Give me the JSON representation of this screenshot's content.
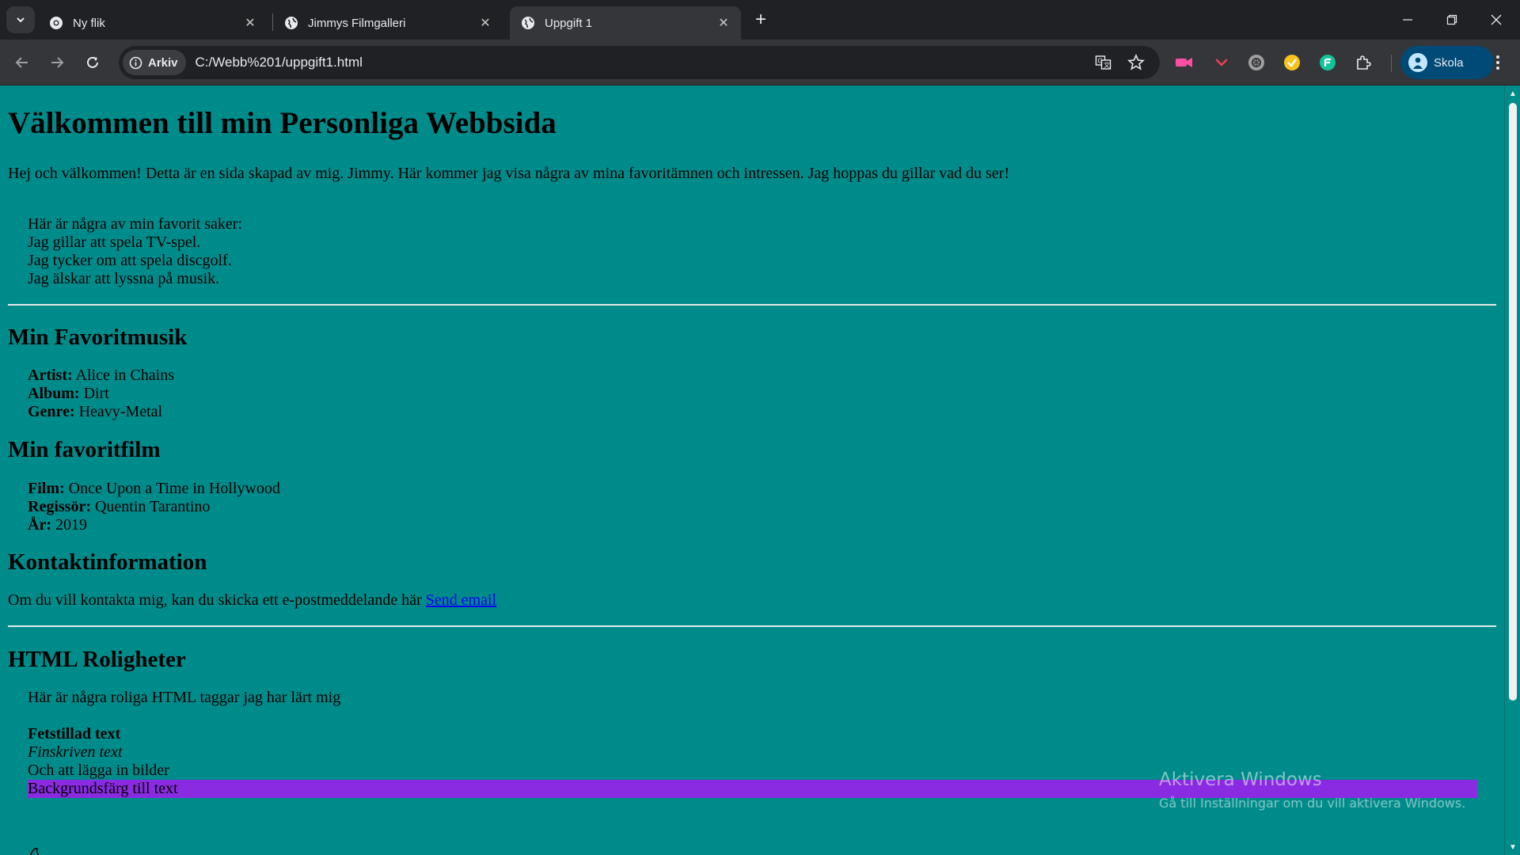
{
  "browser": {
    "tabs": [
      {
        "title": "Ny flik",
        "icon": "chrome-icon"
      },
      {
        "title": "Jimmys Filmgalleri",
        "icon": "globe-icon"
      },
      {
        "title": "Uppgift 1",
        "icon": "globe-icon",
        "active": true
      }
    ],
    "address": {
      "chip_label": "Arkiv",
      "url": "C:/Webb%201/uppgift1.html"
    },
    "profile_label": "Skola"
  },
  "page": {
    "heading": "Välkommen till min Personliga Webbsida",
    "intro": "Hej och välkommen! Detta är en sida skapad av mig. Jimmy. Här kommer jag visa några av mina favoritämnen och intressen. Jag hoppas du gillar vad du ser!",
    "favorites": [
      "Här är några av min favorit saker:",
      "Jag gillar att spela TV-spel.",
      "Jag tycker om att spela discgolf.",
      "Jag älskar att lyssna på musik."
    ],
    "music": {
      "heading": "Min Favoritmusik",
      "rows": [
        {
          "label": "Artist:",
          "value": "Alice in Chains"
        },
        {
          "label": "Album:",
          "value": "Dirt"
        },
        {
          "label": "Genre:",
          "value": "Heavy-Metal"
        }
      ]
    },
    "film": {
      "heading": "Min favoritfilm",
      "rows": [
        {
          "label": "Film:",
          "value": "Once Upon a Time in Hollywood"
        },
        {
          "label": "Regissör:",
          "value": "Quentin Tarantino"
        },
        {
          "label": "År:",
          "value": "2019"
        }
      ]
    },
    "contact": {
      "heading": "Kontaktinformation",
      "text": "Om du vill kontakta mig, kan du skicka ett e-postmeddelande här",
      "link_label": "Send email"
    },
    "fun": {
      "heading": "HTML Roligheter",
      "intro": "Här är några roliga HTML taggar jag har lärt mig",
      "bold": "Fetstillad text",
      "italic": "Finskriven text",
      "plain": "Och att lägga in bilder",
      "highlight": "Backgrundsfärg till text"
    },
    "colors": {
      "background": "#008b8b",
      "highlight": "#8a2be2",
      "link": "#0000ee"
    }
  },
  "watermark": {
    "title": "Aktivera Windows",
    "subtitle": "Gå till Inställningar om du vill aktivera Windows."
  }
}
